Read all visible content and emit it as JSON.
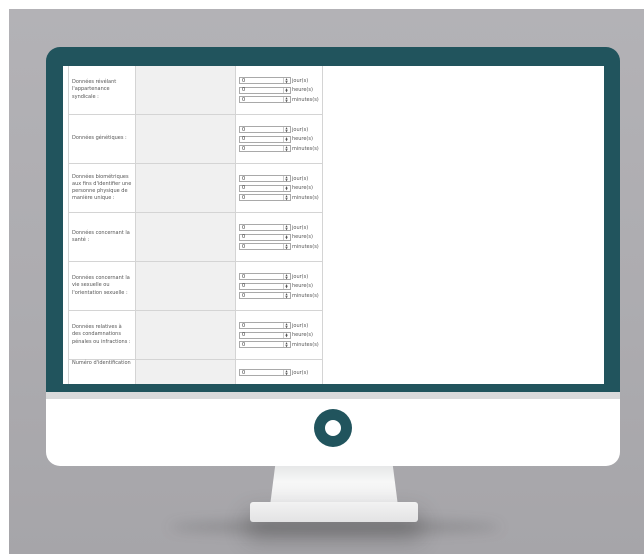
{
  "form": {
    "rows": [
      {
        "label": "Données révélant l'appartenance syndicale :",
        "values": [
          "0",
          "0",
          "0"
        ]
      },
      {
        "label": "Données génétiques :",
        "values": [
          "0",
          "0",
          "0"
        ]
      },
      {
        "label": "Données biométriques aux fins d'identifier une personne physique de manière unique :",
        "values": [
          "0",
          "0",
          "0"
        ]
      },
      {
        "label": "Données concernant la santé :",
        "values": [
          "0",
          "0",
          "0"
        ]
      },
      {
        "label": "Données concernant la vie sexuelle ou l'orientation sexuelle :",
        "values": [
          "0",
          "0",
          "0"
        ]
      },
      {
        "label": "Données relatives à des condamnations pénales ou infractions :",
        "values": [
          "0",
          "0",
          "0"
        ]
      },
      {
        "label": "Numéro d'identification",
        "values": [
          "0"
        ]
      }
    ],
    "units": [
      "jour(s)",
      "heure(s)",
      "minutes(s)"
    ]
  },
  "colors": {
    "frame": "#21545d",
    "backdrop": "#adacb0"
  }
}
